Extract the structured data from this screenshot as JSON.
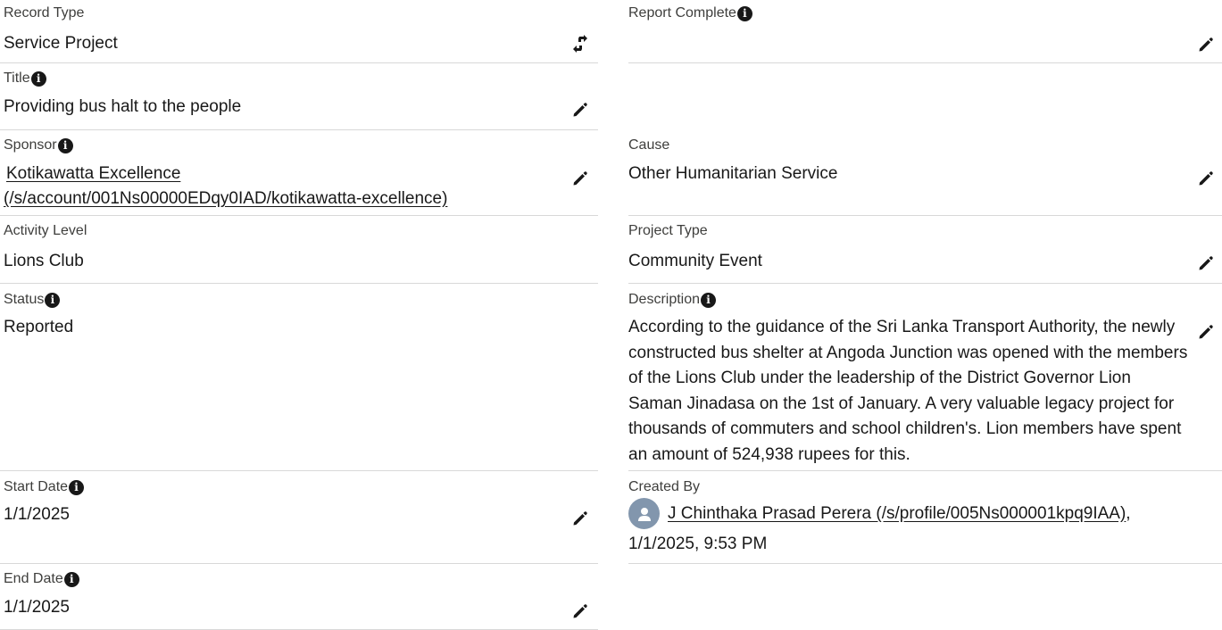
{
  "fields": {
    "record_type": {
      "label": "Record Type",
      "value": "Service Project",
      "action_icon": "change-record-type-icon"
    },
    "report_complete": {
      "label": "Report Complete",
      "value": "",
      "action_icon": "pencil-icon"
    },
    "title": {
      "label": "Title",
      "value": "Providing bus halt to the people",
      "action_icon": "pencil-icon"
    },
    "sponsor": {
      "label": "Sponsor",
      "link_line1": "Kotikawatta Excellence",
      "link_line2": "(/s/account/001Ns00000EDqy0IAD/kotikawatta-excellence)",
      "action_icon": "pencil-icon"
    },
    "cause": {
      "label": "Cause",
      "value": "Other Humanitarian Service",
      "action_icon": "pencil-icon"
    },
    "activity_level": {
      "label": "Activity Level",
      "value": "Lions Club"
    },
    "project_type": {
      "label": "Project Type",
      "value": "Community Event",
      "action_icon": "pencil-icon"
    },
    "status": {
      "label": "Status",
      "value": "Reported"
    },
    "description": {
      "label": "Description",
      "value": "According to the guidance of the Sri Lanka Transport Authority, the newly constructed bus shelter at Angoda Junction was opened with the members of the Lions Club under the leadership of the District Governor Lion Saman Jinadasa on the 1st of January. A very valuable legacy project for thousands of commuters and school children's. Lion members have spent an amount of 524,938 rupees for this.",
      "action_icon": "pencil-icon"
    },
    "start_date": {
      "label": "Start Date",
      "value": "1/1/2025",
      "action_icon": "pencil-icon"
    },
    "created_by": {
      "label": "Created By",
      "user_link": "J Chinthaka Prasad Perera (/s/profile/005Ns000001kpq9IAA)",
      "separator": ",",
      "timestamp": "1/1/2025, 9:53 PM",
      "avatar_icon": "user-avatar-icon"
    },
    "end_date": {
      "label": "End Date",
      "value": "1/1/2025",
      "action_icon": "pencil-icon"
    }
  },
  "icons": {
    "info": "info-icon",
    "info_glyph": "i",
    "info_color": "#181818",
    "avatar_bg": "#8296ad"
  }
}
